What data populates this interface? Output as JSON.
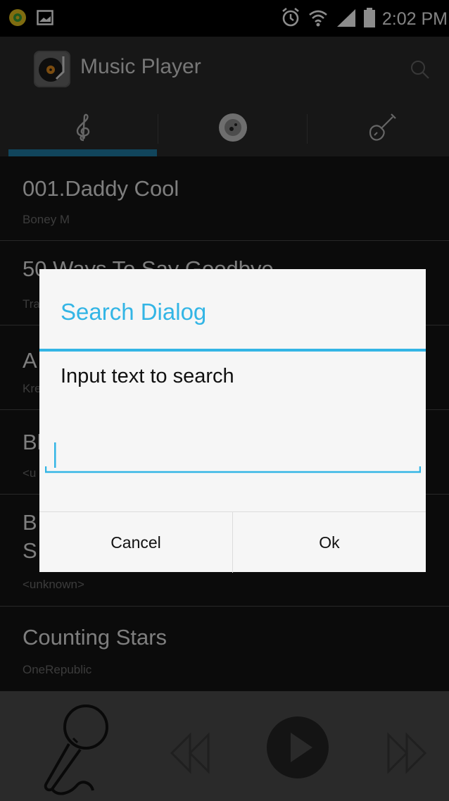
{
  "status_bar": {
    "time": "2:02 PM",
    "icons": [
      "app-notification-icon",
      "image-notification-icon",
      "alarm-icon",
      "wifi-icon",
      "signal-icon",
      "battery-icon"
    ]
  },
  "action_bar": {
    "title": "Music Player",
    "icon": "turntable-icon",
    "search_icon": "search-icon"
  },
  "tabs": [
    {
      "icon": "treble-clef-icon",
      "selected": true
    },
    {
      "icon": "disc-icon",
      "selected": false
    },
    {
      "icon": "violin-icon",
      "selected": false
    }
  ],
  "songs": [
    {
      "title": "001.Daddy Cool",
      "artist": "Boney M"
    },
    {
      "title": "50 Ways To Say Goodbye",
      "artist": "Tra"
    },
    {
      "title": "A",
      "artist": "Kre"
    },
    {
      "title": "Bl",
      "artist": "<u"
    },
    {
      "title": "B",
      "title_line2": "S",
      "artist": "<unknown>"
    },
    {
      "title": "Counting Stars",
      "artist": "OneRepublic"
    }
  ],
  "player": {
    "icons": [
      "microphone-icon",
      "rewind-icon",
      "play-icon",
      "fast-forward-icon"
    ]
  },
  "dialog": {
    "title": "Search Dialog",
    "message": "Input text to search",
    "input_value": "",
    "cancel_label": "Cancel",
    "ok_label": "Ok"
  },
  "colors": {
    "accent": "#33b5e5",
    "tab_indicator": "#1f7ea8",
    "action_bar": "#2a2a2a",
    "dialog_bg": "#f6f6f6"
  }
}
